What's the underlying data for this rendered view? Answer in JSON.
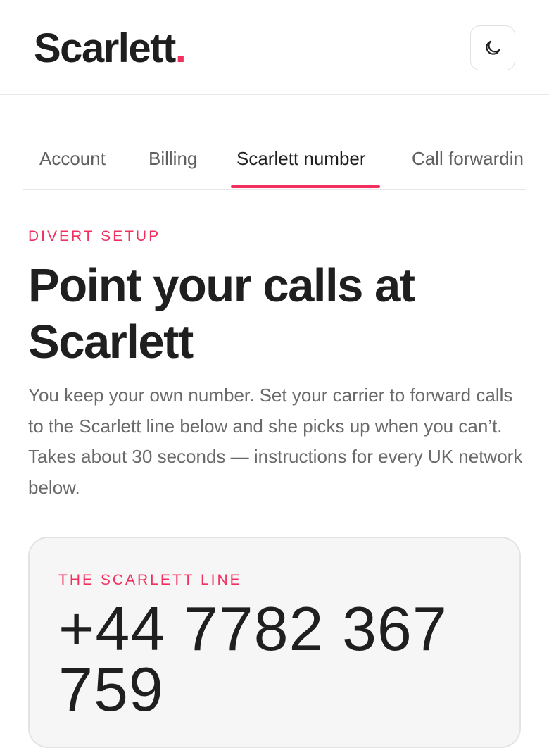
{
  "header": {
    "logo_text": "Scarlett",
    "logo_dot": ".",
    "theme_toggle_icon": "moon-icon"
  },
  "tabs": [
    {
      "label": "Account",
      "active": false
    },
    {
      "label": "Billing",
      "active": false
    },
    {
      "label": "Scarlett number",
      "active": true
    },
    {
      "label": "Call forwardin",
      "active": false
    }
  ],
  "colors": {
    "accent": "#f2305f",
    "text": "#1f1f1f",
    "muted": "#6a6a6a",
    "card_bg": "#f6f6f6"
  },
  "main": {
    "eyebrow": "DIVERT SETUP",
    "title": "Point your calls at Scarlett",
    "intro": "You keep your own number. Set your carrier to forward calls to the Scarlett line below and she picks up when you can’t. Takes about 30 seconds — instructions for every UK network below."
  },
  "card": {
    "eyebrow": "THE SCARLETT LINE",
    "number": "+44 7782 367 759"
  }
}
